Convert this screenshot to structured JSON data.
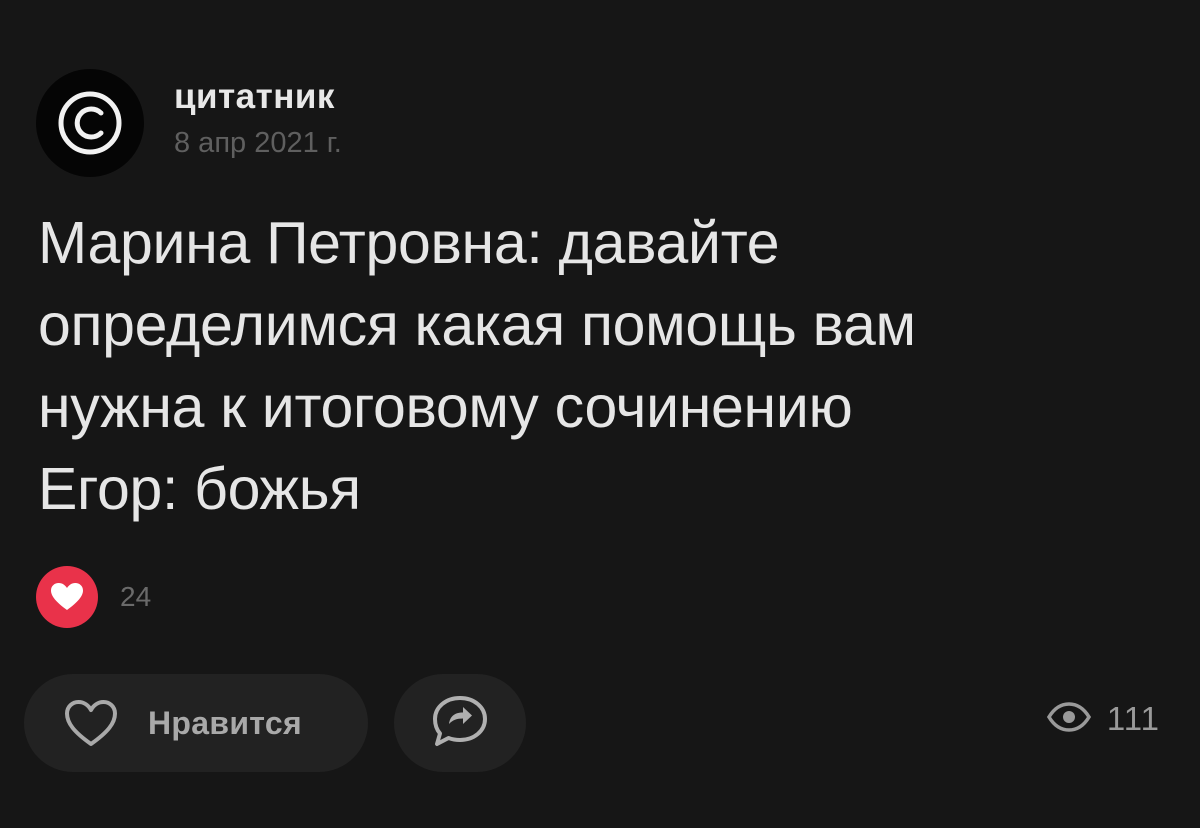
{
  "author": {
    "name": "цитатник",
    "date": "8 апр 2021 г.",
    "avatar_icon": "copyright-icon"
  },
  "post": {
    "lines": [
      "Марина Петровна: давайте",
      "определимся какая помощь вам",
      "нужна к итоговому сочинению",
      "Егор: божья"
    ]
  },
  "reactions": {
    "icon": "heart-reaction-icon",
    "count": "24"
  },
  "actions": {
    "like_label": "Нравится",
    "like_icon": "heart-outline-icon",
    "share_icon": "share-bubble-icon"
  },
  "views": {
    "icon": "eye-icon",
    "count": "111"
  },
  "colors": {
    "background": "#161616",
    "button_bg": "#222222",
    "reaction_red": "#e9324a"
  }
}
